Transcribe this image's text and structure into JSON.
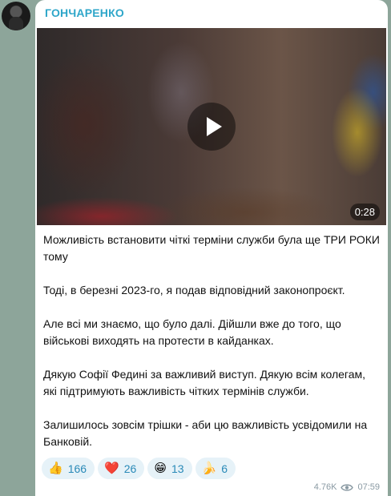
{
  "channel": {
    "author": "ГОНЧАРЕНКО",
    "avatar_icon": "profile-photo"
  },
  "video": {
    "duration": "0:28",
    "play_icon": "play-icon"
  },
  "message": {
    "paragraphs": [
      "Можливість встановити чіткі терміни служби була ще ТРИ РОКИ тому",
      "Тоді, в березні 2023-го, я подав відповідний законопроєкт.",
      "Але всі ми знаємо, що було далі. Дійшли вже до того, що військові виходять на протести в кайданках.",
      "Дякую Софії Федині за важливий виступ. Дякую всім колегам, які підтримують важливість чітких термінів служби.",
      "Залишилось зовсім трішки - аби цю важливість усвідомили на Банковій."
    ]
  },
  "reactions": [
    {
      "emoji": "👍",
      "icon": "thumbs-up-icon",
      "count": "166"
    },
    {
      "emoji": "❤️",
      "icon": "heart-icon",
      "count": "26"
    },
    {
      "emoji": "😁",
      "icon": "grin-icon",
      "count": "13"
    },
    {
      "emoji": "🍌",
      "icon": "banana-icon",
      "count": "6"
    }
  ],
  "meta": {
    "views": "4.76K",
    "views_icon": "eye-icon",
    "time": "07:59"
  },
  "colors": {
    "background": "#8da59a",
    "author": "#2ea6c9",
    "reaction_bg": "#e6f2f8",
    "reaction_text": "#2a8ab8",
    "meta_text": "#8a9aa3"
  }
}
